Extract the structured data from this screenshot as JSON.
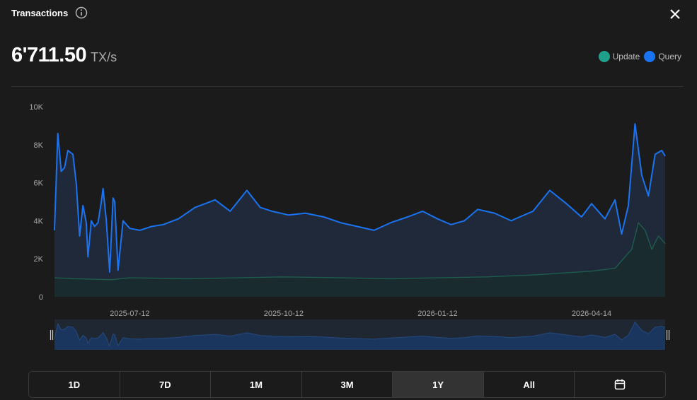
{
  "header": {
    "title": "Transactions"
  },
  "metric": {
    "value": "6'711.50",
    "unit": "TX/s"
  },
  "legend": [
    {
      "label": "Update",
      "color": "#1fa08a"
    },
    {
      "label": "Query",
      "color": "#1a73f0"
    }
  ],
  "range_buttons": [
    "1D",
    "7D",
    "1M",
    "3M",
    "1Y",
    "All"
  ],
  "active_range": "1Y",
  "icons": {
    "info": "info-icon",
    "close": "close-icon",
    "calendar": "calendar-icon"
  },
  "chart_data": {
    "type": "area",
    "title": "",
    "xlabel": "",
    "ylabel": "",
    "ylim": [
      0,
      10000
    ],
    "yticks": [
      0,
      2000,
      4000,
      6000,
      8000,
      10000
    ],
    "ytick_labels": [
      "0",
      "2K",
      "4K",
      "6K",
      "8K",
      "10K"
    ],
    "xtick_labels": [
      "2025-07-12",
      "2025-10-12",
      "2026-01-12",
      "2026-04-14"
    ],
    "x_start": "2025-05-28",
    "x_end": "2026-05-28",
    "grid": false,
    "legend_position": "top-right",
    "series": [
      {
        "name": "Query",
        "color": "#1a73f0",
        "x": [
          "2025-05-28",
          "2025-05-30",
          "2025-06-01",
          "2025-06-03",
          "2025-06-05",
          "2025-06-08",
          "2025-06-10",
          "2025-06-12",
          "2025-06-14",
          "2025-06-16",
          "2025-06-17",
          "2025-06-19",
          "2025-06-21",
          "2025-06-23",
          "2025-06-25",
          "2025-06-26",
          "2025-06-28",
          "2025-06-30",
          "2025-07-02",
          "2025-07-03",
          "2025-07-05",
          "2025-07-08",
          "2025-07-12",
          "2025-07-18",
          "2025-07-25",
          "2025-08-01",
          "2025-08-10",
          "2025-08-20",
          "2025-09-01",
          "2025-09-10",
          "2025-09-20",
          "2025-09-28",
          "2025-10-05",
          "2025-10-15",
          "2025-10-25",
          "2025-11-05",
          "2025-11-15",
          "2025-11-25",
          "2025-12-05",
          "2025-12-15",
          "2025-12-25",
          "2026-01-03",
          "2026-01-12",
          "2026-01-20",
          "2026-01-28",
          "2026-02-05",
          "2026-02-15",
          "2026-02-25",
          "2026-03-02",
          "2026-03-10",
          "2026-03-20",
          "2026-03-30",
          "2026-04-08",
          "2026-04-14",
          "2026-04-22",
          "2026-04-28",
          "2026-05-02",
          "2026-05-06",
          "2026-05-10",
          "2026-05-14",
          "2026-05-18",
          "2026-05-22",
          "2026-05-26",
          "2026-05-28"
        ],
        "values": [
          3500,
          8600,
          6600,
          6800,
          7700,
          7500,
          6000,
          3200,
          4800,
          3900,
          2100,
          4000,
          3700,
          3900,
          5000,
          5700,
          4000,
          1300,
          5200,
          5000,
          1400,
          4000,
          3600,
          3500,
          3700,
          3800,
          4100,
          4700,
          5100,
          4500,
          5600,
          4700,
          4500,
          4300,
          4400,
          4200,
          3900,
          3700,
          3500,
          3900,
          4200,
          4500,
          4100,
          3800,
          4000,
          4600,
          4400,
          4000,
          4200,
          4500,
          5600,
          4900,
          4200,
          4900,
          4100,
          5100,
          3300,
          4800,
          9100,
          6400,
          5300,
          7500,
          7700,
          7400
        ]
      },
      {
        "name": "Update",
        "color": "#1fa08a",
        "x": [
          "2025-05-28",
          "2025-06-10",
          "2025-07-01",
          "2025-07-12",
          "2025-08-15",
          "2025-09-15",
          "2025-10-12",
          "2025-11-15",
          "2025-12-15",
          "2026-01-12",
          "2026-02-10",
          "2026-03-10",
          "2026-04-14",
          "2026-04-28",
          "2026-05-08",
          "2026-05-12",
          "2026-05-16",
          "2026-05-20",
          "2026-05-24",
          "2026-05-28"
        ],
        "values": [
          1000,
          950,
          900,
          1000,
          950,
          1000,
          1050,
          1000,
          950,
          1000,
          1050,
          1150,
          1350,
          1500,
          2500,
          3900,
          3500,
          2500,
          3200,
          2800
        ]
      }
    ]
  }
}
